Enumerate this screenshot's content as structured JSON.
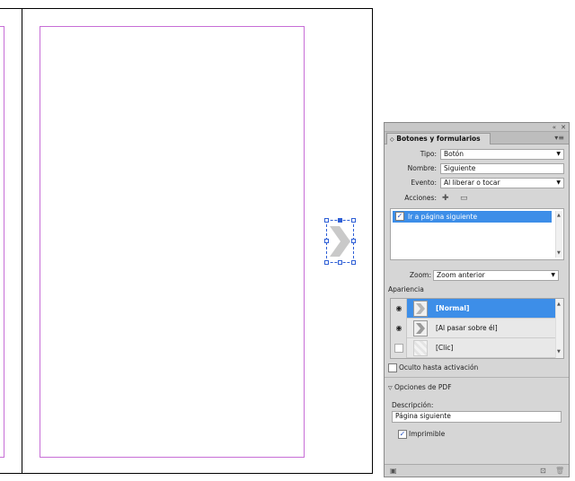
{
  "panel": {
    "title": "Botones y formularios",
    "collapse_icon": "double-chevron-left-icon",
    "close_icon": "close-icon",
    "menu_icon": "panel-menu-icon",
    "fields": {
      "tipo_label": "Tipo:",
      "tipo_value": "Botón",
      "nombre_label": "Nombre:",
      "nombre_value": "Siguiente",
      "evento_label": "Evento:",
      "evento_value": "Al liberar o tocar",
      "acciones_label": "Acciones:"
    },
    "actions": [
      {
        "label": "Ir a página siguiente",
        "checked": true
      }
    ],
    "zoom_label": "Zoom:",
    "zoom_value": "Zoom anterior",
    "apariencia_label": "Apariencia",
    "appearances": [
      {
        "label": "[Normal]",
        "selected": true
      },
      {
        "label": "[Al pasar sobre él]",
        "selected": false
      },
      {
        "label": "[Clic]",
        "selected": false
      }
    ],
    "oculto_label": "Oculto hasta activación",
    "pdf_section_label": "Opciones de PDF",
    "descripcion_label": "Descripción:",
    "descripcion_value": "Página siguiente",
    "imprimible_label": "Imprimible",
    "imprimible_checked": true
  },
  "colors": {
    "selection_blue": "#3d8ee8",
    "margin_guide": "#c76ed6",
    "frame_edge": "#2e5fd6"
  }
}
